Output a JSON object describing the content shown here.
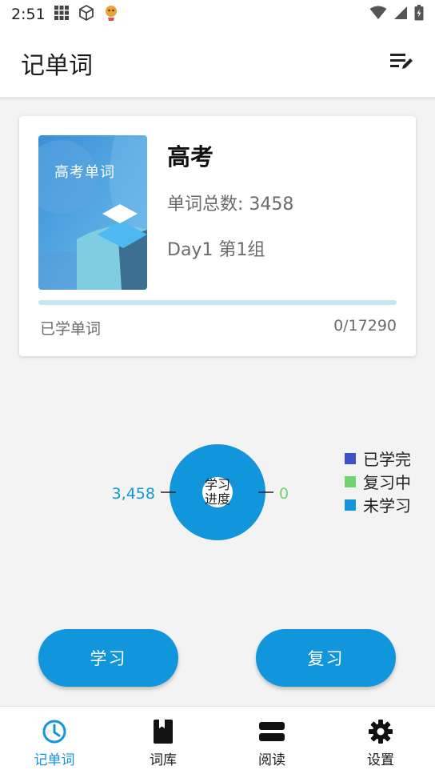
{
  "status_bar": {
    "time": "2:51"
  },
  "app_bar": {
    "title": "记单词"
  },
  "book": {
    "cover_title": "高考单词",
    "name": "高考",
    "total_words": "单词总数: 3458",
    "day_group": "Day1 第1组",
    "progress_fraction": 0,
    "learned_label": "已学单词",
    "learned_count": "0/17290"
  },
  "chart_data": {
    "type": "pie",
    "center_label": "学习进度",
    "slices": [
      {
        "name": "已学完",
        "value": 0,
        "color": "#3f51c8"
      },
      {
        "name": "复习中",
        "value": 0,
        "color": "#71d36b"
      },
      {
        "name": "未学习",
        "value": 3458,
        "color": "#1296db"
      }
    ],
    "callouts": [
      {
        "label": "3,458",
        "color": "#1296db"
      },
      {
        "label": "0",
        "color": "#71d36b"
      }
    ],
    "legend_position": "right"
  },
  "actions": {
    "study_label": "学习",
    "review_label": "复习"
  },
  "nav": {
    "items": [
      {
        "label": "记单词",
        "icon": "clock-icon",
        "active": true
      },
      {
        "label": "词库",
        "icon": "book-icon",
        "active": false
      },
      {
        "label": "阅读",
        "icon": "reading-icon",
        "active": false
      },
      {
        "label": "设置",
        "icon": "gear-icon",
        "active": false
      }
    ],
    "active_color": "#1296db"
  },
  "colors": {
    "accent": "#1296db",
    "progress_track": "#c7e4f3"
  }
}
